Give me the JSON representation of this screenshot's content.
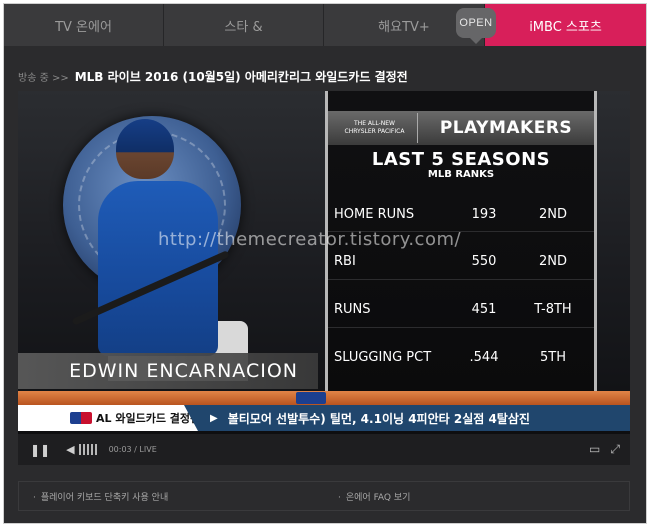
{
  "nav": {
    "tabs": [
      {
        "label": "TV 온에어"
      },
      {
        "label": "스타 &"
      },
      {
        "label": "해요TV+"
      },
      {
        "label": "iMBC 스포츠"
      }
    ],
    "open_badge": "OPEN"
  },
  "broadcast": {
    "prefix": "방송 중 >>",
    "title": "MLB 라이브 2016 (10월5일) 아메리칸리그 와일드카드 결정전"
  },
  "video": {
    "watermark": "http://themecreator.tistory.com/",
    "player_name": "EDWIN ENCARNACION",
    "board": {
      "sponsor_line1": "THE ALL-NEW",
      "sponsor_line2": "CHRYSLER PACIFICA",
      "header": "PLAYMAKERS",
      "title": "LAST 5 SEASONS",
      "subtitle": "MLB RANKS",
      "stats": [
        {
          "label": "HOME RUNS",
          "value": "193",
          "rank": "2ND"
        },
        {
          "label": "RBI",
          "value": "550",
          "rank": "2ND"
        },
        {
          "label": "RUNS",
          "value": "451",
          "rank": "T-8TH"
        },
        {
          "label": "SLUGGING PCT",
          "value": ".544",
          "rank": "5TH"
        }
      ]
    },
    "ticker": {
      "left": "AL 와일드카드 결정전",
      "right": "볼티모어 선발투수) 틸먼, 4.1이닝 4피안타 2실점 4탈삼진"
    },
    "controls": {
      "pause_icon": "pause-icon",
      "volume_icon": "speaker-icon",
      "time": "00:03  /  LIVE"
    }
  },
  "help": {
    "left": "플레이어 키보드 단축키 사용 안내",
    "right": "온에어 FAQ 보기"
  },
  "colors": {
    "accent": "#d81f5a",
    "nav_bg": "#3a3a3c",
    "ticker_blue": "#20466d",
    "ticker_orange": "#c8602a"
  }
}
